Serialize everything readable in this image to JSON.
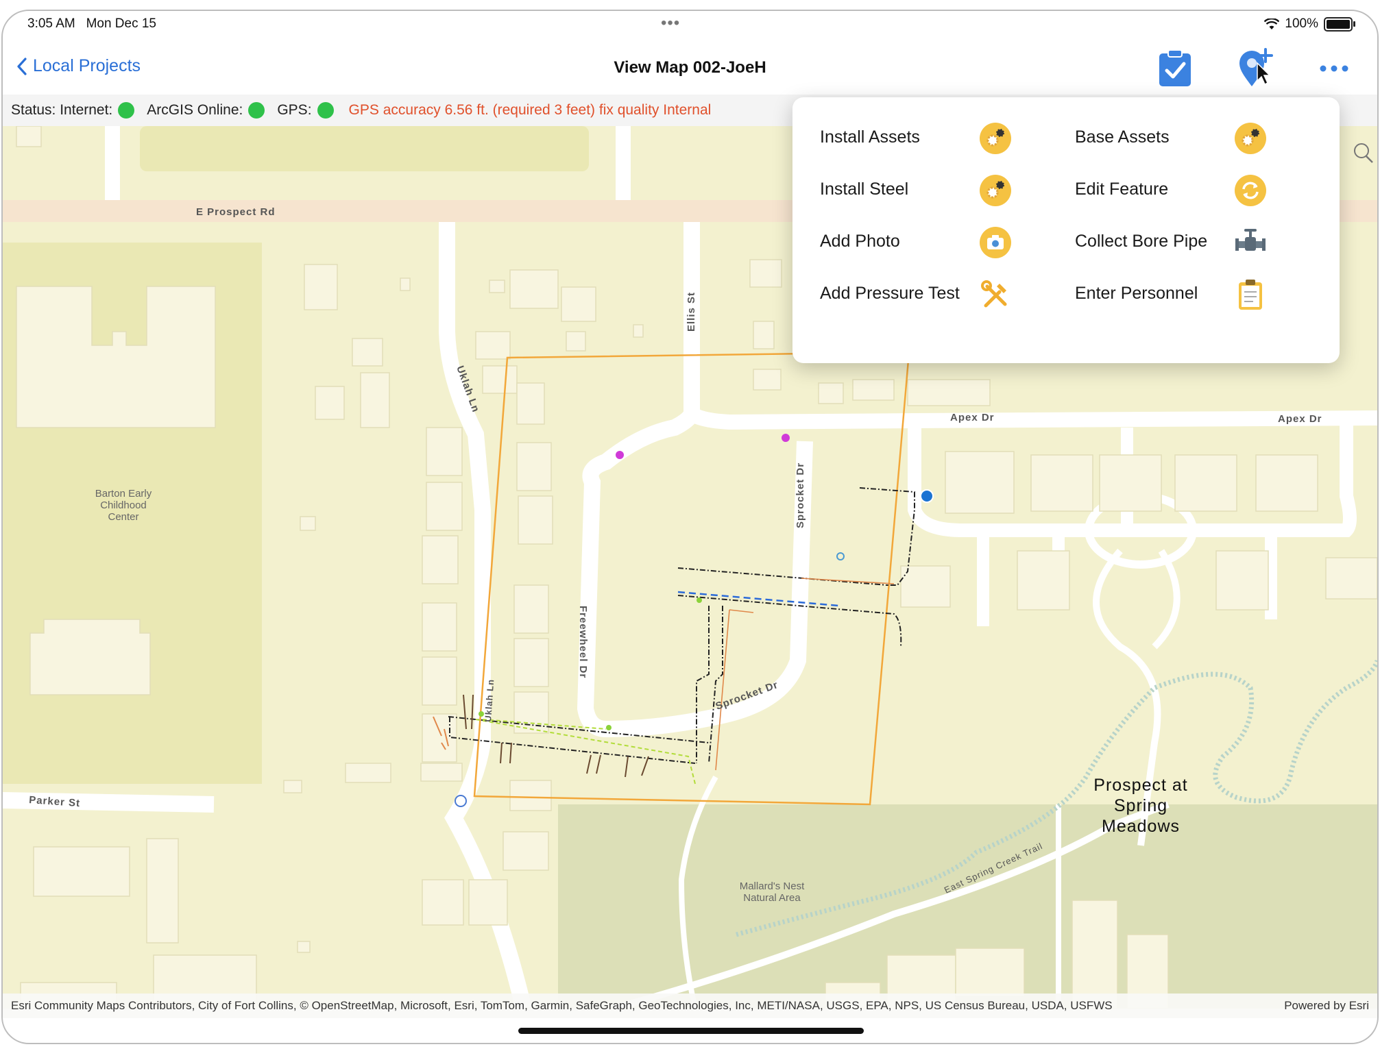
{
  "status_bar": {
    "time": "3:05 AM",
    "date": "Mon Dec 15",
    "battery": "100%"
  },
  "nav": {
    "back_label": "Local Projects",
    "title": "View Map 002-JoeH"
  },
  "status_line": {
    "prefix": "Status:",
    "internet_label": "Internet:",
    "arcgis_label": "ArcGIS Online:",
    "gps_label": "GPS:",
    "gps_warning": "GPS accuracy 6.56 ft. (required 3 feet) fix quality Internal",
    "indicator_color": "#2fc14a"
  },
  "menu": {
    "items": [
      {
        "label": "Install Assets",
        "icon": "gear-icon"
      },
      {
        "label": "Base Assets",
        "icon": "gear-icon"
      },
      {
        "label": "Install Steel",
        "icon": "gear-icon"
      },
      {
        "label": "Edit Feature",
        "icon": "refresh-icon"
      },
      {
        "label": "Add Photo",
        "icon": "camera-icon"
      },
      {
        "label": "Collect Bore Pipe",
        "icon": "valve-icon"
      },
      {
        "label": "Add Pressure Test",
        "icon": "tools-icon"
      },
      {
        "label": "Enter Personnel",
        "icon": "clipboard-icon"
      }
    ]
  },
  "map": {
    "streets": [
      "E Prospect Rd",
      "Uklah Ln",
      "Ellis St",
      "Apex Dr",
      "Apex Dr",
      "Sprocket Dr",
      "Freewheel Dr",
      "Sprocket Dr",
      "Parker St",
      "Uklah Ln",
      "East Spring Creek Trail"
    ],
    "places": {
      "school": [
        "Barton Early",
        "Childhood",
        "Center"
      ],
      "area": [
        "Mallard's Nest",
        "Natural Area"
      ],
      "park": [
        "Prospect at",
        "Spring",
        "Meadows"
      ]
    }
  },
  "attribution": {
    "sources": "Esri Community Maps Contributors, City of Fort Collins, © OpenStreetMap, Microsoft, Esri, TomTom, Garmin, SafeGraph, GeoTechnologies, Inc, METI/NASA, USGS, EPA, NPS, US Census Bureau, USDA, USFWS",
    "powered": "Powered by Esri"
  },
  "colors": {
    "accent_blue": "#2a6fd6",
    "warning_orange": "#e0502b",
    "menu_icon_yellow": "#f5c242",
    "map_background": "#f3f1cf",
    "building": "#f8f5e0",
    "road": "#ffffff",
    "park": "#dcdfb7"
  }
}
